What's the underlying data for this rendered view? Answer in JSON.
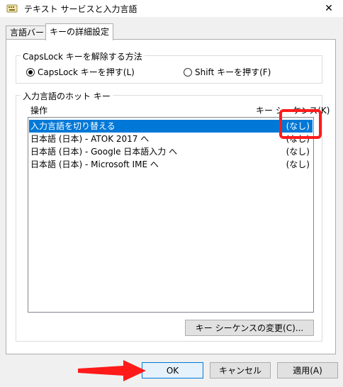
{
  "window": {
    "title": "テキスト サービスと入力言語",
    "close_glyph": "✕"
  },
  "tabs": [
    {
      "label": "言語バー",
      "active": false
    },
    {
      "label": "キーの詳細設定",
      "active": true
    }
  ],
  "capslock_group": {
    "label": "CapsLock キーを解除する方法",
    "options": [
      {
        "label": "CapsLock キーを押す(L)",
        "checked": true
      },
      {
        "label": "Shift キーを押す(F)",
        "checked": false
      }
    ]
  },
  "hotkey_group": {
    "label": "入力言語のホット キー",
    "col_action": "操作",
    "col_sequence": "キー シーケンス(K)",
    "rows": [
      {
        "action": "入力言語を切り替える",
        "sequence": "(なし)",
        "selected": true
      },
      {
        "action": "日本語 (日本) - ATOK 2017 へ",
        "sequence": "(なし)",
        "selected": false
      },
      {
        "action": "日本語 (日本) - Google 日本語入力 へ",
        "sequence": "(なし)",
        "selected": false
      },
      {
        "action": "日本語 (日本) - Microsoft IME へ",
        "sequence": "(なし)",
        "selected": false
      }
    ],
    "change_button": "キー シーケンスの変更(C)..."
  },
  "footer": {
    "ok": "OK",
    "cancel": "キャンセル",
    "apply": "適用(A)"
  },
  "colors": {
    "selection": "#0078d7",
    "annotation_red": "#ff1a1a"
  }
}
